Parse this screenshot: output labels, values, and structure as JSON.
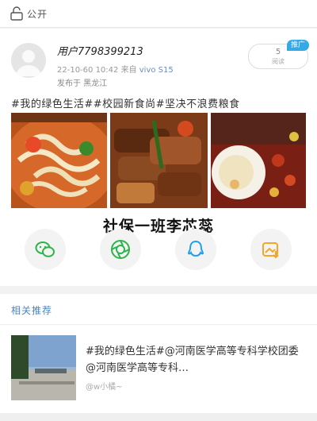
{
  "topbar": {
    "visibility_label": "公开"
  },
  "post": {
    "username": "用户7798399213",
    "timestamp": "22-10-60 10:42",
    "source_prefix": "来自",
    "device": "vivo S15",
    "location": "发布于 黑龙江",
    "read_count": "5",
    "read_label": "阅读",
    "promo_badge": "推广",
    "tags_text": "#我的绿色生活##校园新食尚#坚决不浪费粮食",
    "image_caption": "社保一班李芯蕊"
  },
  "share": [
    {
      "name": "wechat-icon",
      "color": "#2cb44a"
    },
    {
      "name": "moments-icon",
      "color": "#2cb44a"
    },
    {
      "name": "qq-icon",
      "color": "#1ea0f0"
    },
    {
      "name": "qzone-icon",
      "color": "#f5a623"
    }
  ],
  "recommend": {
    "section_title": "相关推荐",
    "title": "#我的绿色生活#@河南医学高等专科学校团委@河南医学高等专科…",
    "source": "@w小橘~"
  }
}
